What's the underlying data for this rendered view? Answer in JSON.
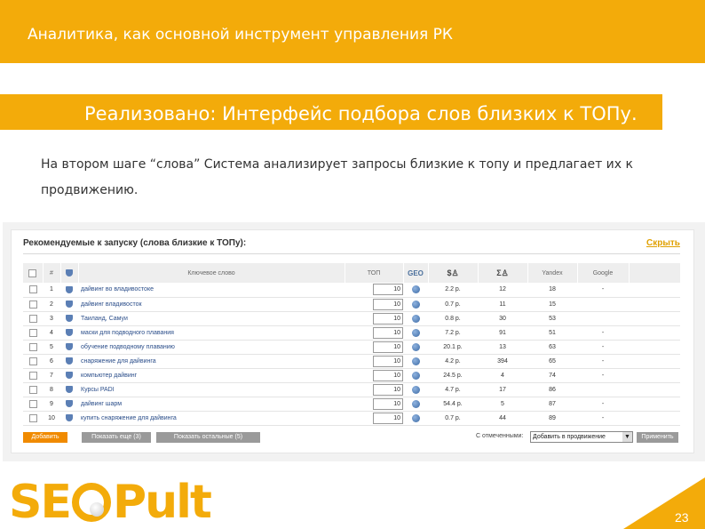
{
  "header": {
    "title": "Аналитика, как основной инструмент управления РК"
  },
  "subheader": {
    "title": "Реализовано: Интерфейс подбора слов близких к ТОПу."
  },
  "description": "На втором шаге “слова” Система анализирует запросы близкие к топу и предлагает их к продвижению.",
  "panel": {
    "title": "Рекомендуемые к запуску (слова близкие к ТОПу):",
    "hide_link": "Скрыть",
    "columns": [
      "#",
      "Ключевое слово",
      "ТОП",
      "GEO",
      "Yandex",
      "Google"
    ],
    "rows": [
      {
        "num": "1",
        "keyword": "дайвинг во владивостоке",
        "top": "10",
        "price": "2.2 р.",
        "c1": "12",
        "yandex": "18",
        "google": "-"
      },
      {
        "num": "2",
        "keyword": "дайвинг владивосток",
        "top": "10",
        "price": "0.7 р.",
        "c1": "11",
        "yandex": "15",
        "google": ""
      },
      {
        "num": "3",
        "keyword": "Таиланд, Самуи",
        "top": "10",
        "price": "0.8 р.",
        "c1": "30",
        "yandex": "53",
        "google": ""
      },
      {
        "num": "4",
        "keyword": "маски для подводного плавания",
        "top": "10",
        "price": "7.2 р.",
        "c1": "91",
        "yandex": "51",
        "google": "-"
      },
      {
        "num": "5",
        "keyword": "обучение подводному плаванию",
        "top": "10",
        "price": "20.1 р.",
        "c1": "13",
        "yandex": "63",
        "google": "-"
      },
      {
        "num": "6",
        "keyword": "снаряжение для дайвинга",
        "top": "10",
        "price": "4.2 р.",
        "c1": "394",
        "yandex": "65",
        "google": "-"
      },
      {
        "num": "7",
        "keyword": "компьютер дайвинг",
        "top": "10",
        "price": "24.5 р.",
        "c1": "4",
        "yandex": "74",
        "google": "-"
      },
      {
        "num": "8",
        "keyword": "Курсы PADI",
        "top": "10",
        "price": "4.7 р.",
        "c1": "17",
        "yandex": "86",
        "google": ""
      },
      {
        "num": "9",
        "keyword": "дайвинг шарм",
        "top": "10",
        "price": "54.4 р.",
        "c1": "5",
        "yandex": "87",
        "google": "-"
      },
      {
        "num": "10",
        "keyword": "купить снаряжение для дайвинга",
        "top": "10",
        "price": "0.7 р.",
        "c1": "44",
        "yandex": "89",
        "google": "-"
      }
    ],
    "btn_add": "Добавить",
    "btn_show": "Показать еще (3)",
    "btn_show_all": "Показать остальные (5)",
    "selected_label": "С отмеченными:",
    "selected_value": "Добавить в продвижение",
    "apply_button": "Применить"
  },
  "footer": {
    "logo": "SEOPult",
    "page_number": "23"
  },
  "colors": {
    "accent": "#f3ab0a",
    "button_orange": "#f08a00"
  },
  "icons": [
    "shield-icon",
    "globe-icon",
    "checkbox"
  ]
}
